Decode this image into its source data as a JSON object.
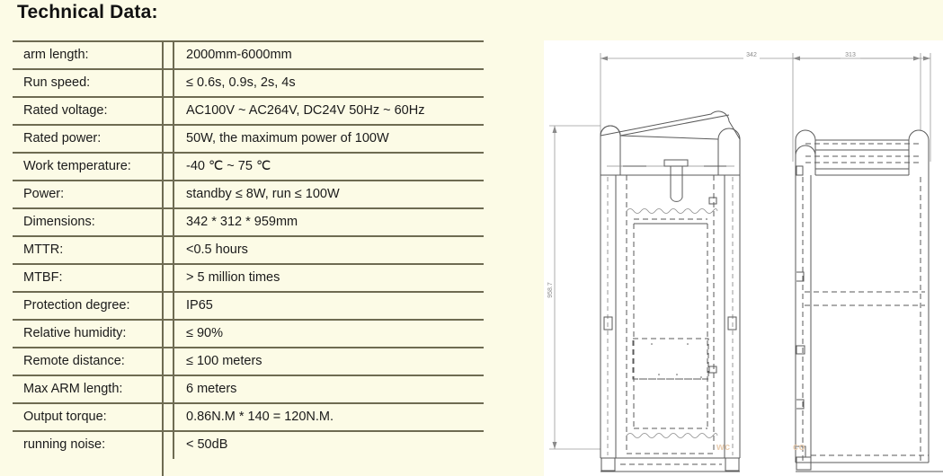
{
  "page": {
    "title": "Technical Data:",
    "background_color": "#FCFBE6",
    "rule_color": "#6E6B52"
  },
  "spec_table": {
    "rows": [
      {
        "key": "arm length:",
        "value": "2000mm-6000mm"
      },
      {
        "key": "Run speed:",
        "value": "≤ 0.6s, 0.9s, 2s, 4s"
      },
      {
        "key": "Rated voltage:",
        "value": "AC100V ~ AC264V, DC24V 50Hz ~ 60Hz"
      },
      {
        "key": "Rated power:",
        "value": "50W, the maximum power of 100W"
      },
      {
        "key": "Work temperature:",
        "value": "-40 ℃ ~ 75 ℃"
      },
      {
        "key": "Power:",
        "value": "standby ≤ 8W, run ≤ 100W"
      },
      {
        "key": "Dimensions:",
        "value": "342 * 312 * 959mm"
      },
      {
        "key": "MTTR:",
        "value": "<0.5 hours"
      },
      {
        "key": "MTBF:",
        "value": "> 5 million times"
      },
      {
        "key": "Protection degree:",
        "value": "IP65"
      },
      {
        "key": "Relative humidity:",
        "value": "≤ 90%"
      },
      {
        "key": "Remote distance:",
        "value": "≤ 100 meters"
      },
      {
        "key": "Max ARM length:",
        "value": "6 meters"
      },
      {
        "key": "Output torque:",
        "value": "0.86N.M * 140 = 120N.M."
      },
      {
        "key": "running noise:",
        "value": "< 50dB"
      }
    ]
  },
  "drawing": {
    "background_color": "#FFFFFF",
    "line_color": "#5a5a5a",
    "front_view": {
      "width_dimension": "342",
      "height_dimension": "958.7",
      "watermark": "wc"
    },
    "side_view": {
      "width_dimension": "313",
      "watermark": "co"
    }
  }
}
